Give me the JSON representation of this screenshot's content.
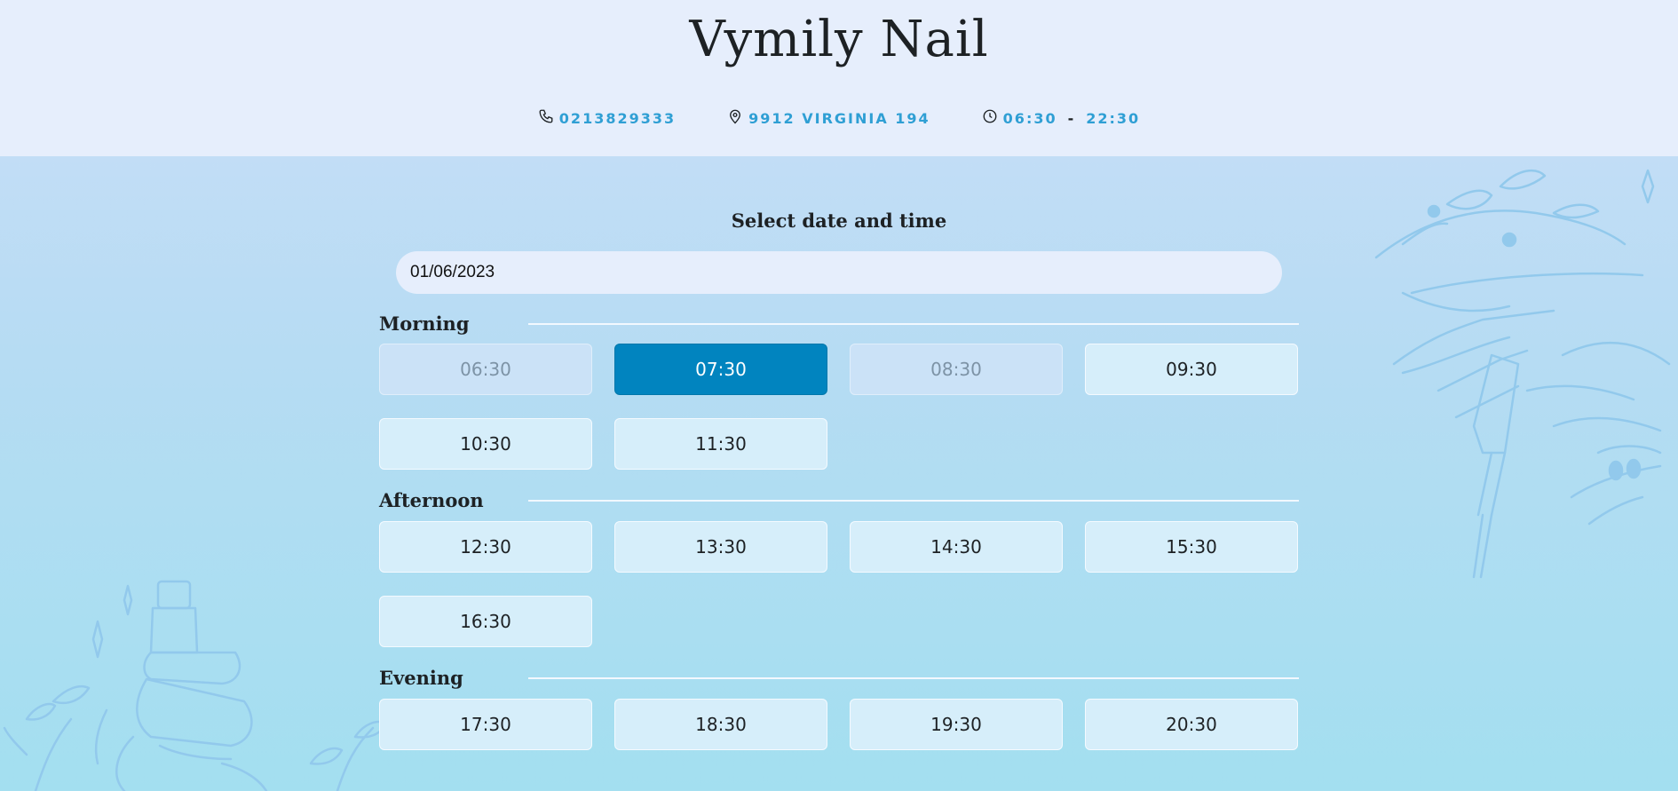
{
  "brand": {
    "name": "Vymily Nail"
  },
  "contact": {
    "phone": "0213829333",
    "address": "9912 VIRGINIA 194",
    "hours_open": "06:30",
    "hours_sep": "-",
    "hours_close": "22:30"
  },
  "booking": {
    "title": "Select date and time",
    "date_value": "01/06/2023",
    "sections": [
      {
        "label": "Morning",
        "slots": [
          {
            "time": "06:30",
            "state": "disabled"
          },
          {
            "time": "07:30",
            "state": "selected"
          },
          {
            "time": "08:30",
            "state": "disabled"
          },
          {
            "time": "09:30",
            "state": "available"
          },
          {
            "time": "10:30",
            "state": "available"
          },
          {
            "time": "11:30",
            "state": "available"
          }
        ]
      },
      {
        "label": "Afternoon",
        "slots": [
          {
            "time": "12:30",
            "state": "available"
          },
          {
            "time": "13:30",
            "state": "available"
          },
          {
            "time": "14:30",
            "state": "available"
          },
          {
            "time": "15:30",
            "state": "available"
          },
          {
            "time": "16:30",
            "state": "available"
          }
        ]
      },
      {
        "label": "Evening",
        "slots": [
          {
            "time": "17:30",
            "state": "available"
          },
          {
            "time": "18:30",
            "state": "available"
          },
          {
            "time": "19:30",
            "state": "available"
          },
          {
            "time": "20:30",
            "state": "available"
          }
        ]
      }
    ]
  },
  "colors": {
    "accent": "#0184bf",
    "contact_text": "#2f9fd4",
    "header_bg": "#e6eefc",
    "slot_bg": "#d6eefa"
  },
  "icons": {
    "phone": "phone-icon",
    "location": "location-pin-icon",
    "clock": "clock-icon"
  }
}
